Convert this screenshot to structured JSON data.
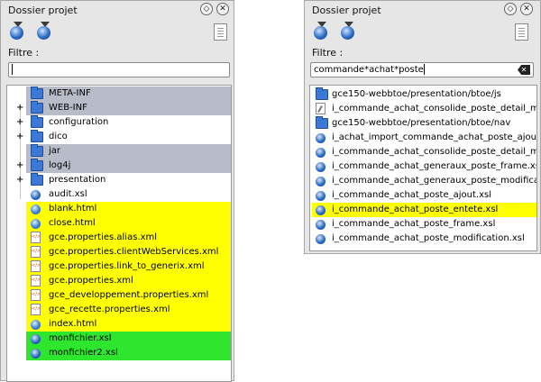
{
  "left": {
    "title": "Dossier projet",
    "filter_label": "Filtre :",
    "filter_value": "",
    "toolbar": [
      "refresh-globe-icon",
      "synchronize-globe-icon",
      "notepad-icon"
    ],
    "rows": [
      {
        "label": "META-INF",
        "icon": "folder-icon",
        "highlight": "gray",
        "expander": ""
      },
      {
        "label": "WEB-INF",
        "icon": "folder-icon",
        "highlight": "gray",
        "expander": "+"
      },
      {
        "label": "configuration",
        "icon": "folder-icon",
        "highlight": "",
        "expander": "+"
      },
      {
        "label": "dico",
        "icon": "folder-icon",
        "highlight": "",
        "expander": "+"
      },
      {
        "label": "jar",
        "icon": "folder-icon",
        "highlight": "gray",
        "expander": ""
      },
      {
        "label": "log4j",
        "icon": "folder-icon",
        "highlight": "gray",
        "expander": "+"
      },
      {
        "label": "presentation",
        "icon": "folder-icon",
        "highlight": "",
        "expander": "+"
      },
      {
        "label": "audit.xsl",
        "icon": "xsl-icon",
        "highlight": "",
        "expander": ""
      },
      {
        "label": "blank.html",
        "icon": "html-icon",
        "highlight": "yellow",
        "expander": ""
      },
      {
        "label": "close.html",
        "icon": "html-icon",
        "highlight": "yellow",
        "expander": ""
      },
      {
        "label": "gce.properties.alias.xml",
        "icon": "xml-icon",
        "highlight": "yellow",
        "expander": ""
      },
      {
        "label": "gce.properties.clientWebServices.xml",
        "icon": "xml-icon",
        "highlight": "yellow",
        "expander": ""
      },
      {
        "label": "gce.properties.link_to_generix.xml",
        "icon": "xml-icon",
        "highlight": "yellow",
        "expander": ""
      },
      {
        "label": "gce.properties.xml",
        "icon": "xml-icon",
        "highlight": "yellow",
        "expander": ""
      },
      {
        "label": "gce_developpement.properties.xml",
        "icon": "xml-icon",
        "highlight": "yellow",
        "expander": ""
      },
      {
        "label": "gce_recette.properties.xml",
        "icon": "xml-icon",
        "highlight": "yellow",
        "expander": ""
      },
      {
        "label": "index.html",
        "icon": "html-icon",
        "highlight": "yellow",
        "expander": ""
      },
      {
        "label": "monfichier.xsl",
        "icon": "xsl-icon",
        "highlight": "green",
        "expander": ""
      },
      {
        "label": "monfichier2.xsl",
        "icon": "xsl-icon",
        "highlight": "green",
        "expander": ""
      }
    ]
  },
  "right": {
    "title": "Dossier projet",
    "filter_label": "Filtre :",
    "filter_value": "commande*achat*poste",
    "rows": [
      {
        "label": "gce150-webbtoe/presentation/btoe/js",
        "icon": "folder-icon",
        "highlight": ""
      },
      {
        "label": "i_commande_achat_consolide_poste_detail_m",
        "icon": "quill-file-icon",
        "highlight": ""
      },
      {
        "label": "gce150-webbtoe/presentation/btoe/nav",
        "icon": "folder-icon",
        "highlight": ""
      },
      {
        "label": "i_achat_import_commande_achat_poste_ajout",
        "icon": "xsl-icon",
        "highlight": ""
      },
      {
        "label": "i_commande_achat_consolide_poste_detail_m",
        "icon": "xsl-icon",
        "highlight": ""
      },
      {
        "label": "i_commande_achat_generaux_poste_frame.xs",
        "icon": "xsl-icon",
        "highlight": ""
      },
      {
        "label": "i_commande_achat_generaux_poste_modificat",
        "icon": "xsl-icon",
        "highlight": ""
      },
      {
        "label": "i_commande_achat_poste_ajout.xsl",
        "icon": "xsl-icon",
        "highlight": ""
      },
      {
        "label": "i_commande_achat_poste_entete.xsl",
        "icon": "xsl-icon",
        "highlight": "yellow"
      },
      {
        "label": "i_commande_achat_poste_frame.xsl",
        "icon": "xsl-icon",
        "highlight": ""
      },
      {
        "label": "i_commande_achat_poste_modification.xsl",
        "icon": "xsl-icon",
        "highlight": ""
      }
    ]
  },
  "colors": {
    "gray_highlight": "#b8bcc8",
    "yellow_highlight": "#ffff00",
    "green_highlight": "#2ee62e",
    "folder": "#3b78d8"
  }
}
